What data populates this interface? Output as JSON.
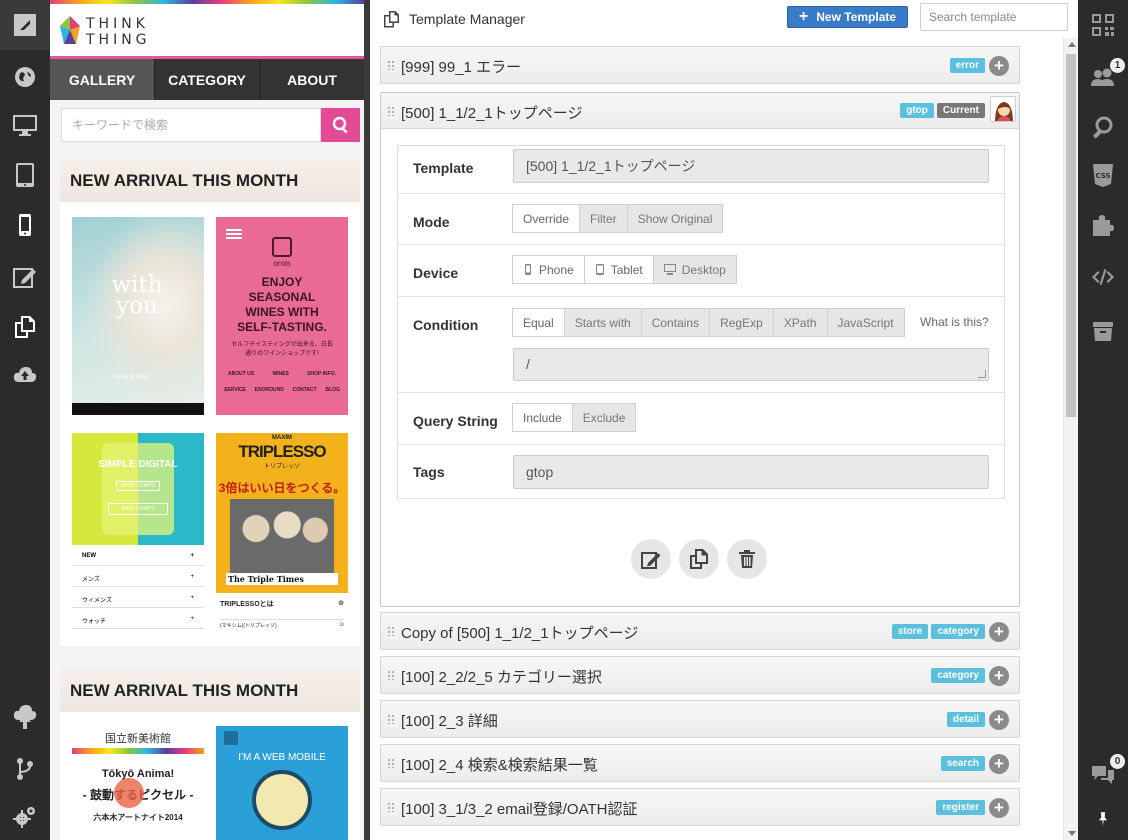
{
  "preview": {
    "logo_text_line1": "THINK",
    "logo_text_line2": "THING",
    "nav": [
      {
        "label": "GALLERY"
      },
      {
        "label": "CATEGORY"
      },
      {
        "label": "ABOUT"
      }
    ],
    "search_placeholder": "キーワードで検索",
    "section_title_1": "NEW ARRIVAL THIS MONTH",
    "section_title_2": "NEW ARRIVAL THIS MONTH",
    "thumbs": {
      "t1_title": "with you",
      "t1_brand": "VENUS BED",
      "t2_brand": "ornis",
      "t2_title": "ENJOY SEASONAL WINES WITH SELF-TASTING.",
      "t2_sub": "セルフテイスティングが出来る、日長通りのワインショップです!",
      "t2_links": [
        "ABOUT US",
        "WINES",
        "SHOP INFO."
      ],
      "t2_links2": [
        "SERVICE",
        "ENOROUND",
        "CONTACT",
        "BLOG"
      ],
      "t3_title": "SIMPLE DIGITAL",
      "t3_btn1": "SHOP COMP'S",
      "t3_btn2": "SHOP COMP'S",
      "t3_menu": [
        "NEW",
        "メンズ",
        "ウィメンズ",
        "ウォッチ"
      ],
      "t4_brand": "MAXIM",
      "t4_title": "TRIPLESSO",
      "t4_kana": "トリプレッソ",
      "t4_slogan": "3倍はいい日をつくる。",
      "t4_paper": "The Triple Times",
      "t4_link1": "TRIPLESSOとは",
      "t4_link2": "(マキシム)(トリプレッソ)",
      "t5_title": "国立新美術館",
      "t5_sub": "Tōkyō Anima!",
      "t5_main": "- 鼓動するピクセル -",
      "t5_foot": "六本木アートナイト2014",
      "t6_title": "I'M A WEB MOBILE"
    }
  },
  "main": {
    "title": "Template Manager",
    "new_button": "New Template",
    "search_placeholder": "Search template",
    "templates": [
      {
        "name": "[999] 99_1 エラー",
        "tags": [
          "error"
        ]
      },
      {
        "name": "[500] 1_1/2_1トップページ",
        "tags": [
          "gtop",
          "Current"
        ]
      },
      {
        "name": "Copy of [500] 1_1/2_1トップページ",
        "tags": [
          "store",
          "category"
        ]
      },
      {
        "name": "[100] 2_2/2_5 カテゴリー選択",
        "tags": [
          "category"
        ]
      },
      {
        "name": "[100] 2_3 詳細",
        "tags": [
          "detail"
        ]
      },
      {
        "name": "[100] 2_4 検索&検索結果一覧",
        "tags": [
          "search"
        ]
      },
      {
        "name": "[100] 3_1/3_2 email登録/OATH認証",
        "tags": [
          "register"
        ]
      }
    ],
    "form": {
      "template_label": "Template",
      "template_value": "[500] 1_1/2_1トップページ",
      "mode_label": "Mode",
      "mode_options": [
        "Override",
        "Filter",
        "Show Original"
      ],
      "device_label": "Device",
      "device_options": [
        "Phone",
        "Tablet",
        "Desktop"
      ],
      "condition_label": "Condition",
      "condition_options": [
        "Equal",
        "Starts with",
        "Contains",
        "RegExp",
        "XPath",
        "JavaScript"
      ],
      "condition_help": "What is this?",
      "condition_value": "/",
      "query_label": "Query String",
      "query_options": [
        "Include",
        "Exclude"
      ],
      "tags_label": "Tags",
      "tags_value": "gtop"
    }
  },
  "right_rail": {
    "users_badge": "1",
    "comments_badge": "0"
  }
}
